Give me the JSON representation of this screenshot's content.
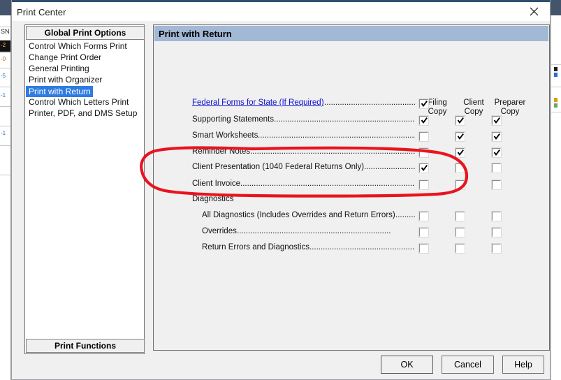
{
  "window": {
    "title": "Print Center",
    "close_icon": "close-icon"
  },
  "sidebar": {
    "header": "Global Print Options",
    "footer_button": "Print Functions",
    "items": [
      {
        "label": "Control Which Forms Print",
        "selected": false
      },
      {
        "label": "Change Print Order",
        "selected": false
      },
      {
        "label": "General Printing",
        "selected": false
      },
      {
        "label": "Print with Organizer",
        "selected": false
      },
      {
        "label": "Print with Return",
        "selected": true
      },
      {
        "label": "Control Which Letters Print",
        "selected": false
      },
      {
        "label": "Printer, PDF, and DMS Setup",
        "selected": false
      }
    ],
    "selected_index": 4
  },
  "main": {
    "header": "Print with Return",
    "columns": [
      {
        "line1": "Filing",
        "line2": "Copy"
      },
      {
        "line1": "Client",
        "line2": "Copy"
      },
      {
        "line1": "Preparer",
        "line2": "Copy"
      }
    ],
    "rows": [
      {
        "label": "Federal Forms for State (If Required)",
        "type": "link",
        "indent": false,
        "dots": "..........................................",
        "checks": [
          true,
          null,
          null
        ]
      },
      {
        "label": "Supporting Statements",
        "type": "text",
        "indent": false,
        "dots": "..................................................................",
        "checks": [
          true,
          true,
          true
        ]
      },
      {
        "label": "Smart Worksheets",
        "type": "text",
        "indent": false,
        "dots": "........................................................................",
        "checks": [
          false,
          true,
          true
        ]
      },
      {
        "label": "Reminder Notes",
        "type": "text",
        "indent": false,
        "dots": "............................................................................",
        "checks": [
          false,
          true,
          true
        ]
      },
      {
        "label": "Client Presentation (1040 Federal Returns Only)",
        "type": "text",
        "indent": false,
        "dots": "..................................",
        "checks": [
          true,
          false,
          false
        ]
      },
      {
        "label": "Client Invoice",
        "type": "text",
        "indent": false,
        "dots": "...............................................................................",
        "checks": [
          false,
          false,
          false
        ]
      },
      {
        "label": "Diagnostics",
        "type": "group",
        "indent": false,
        "dots": "",
        "checks": [
          null,
          null,
          null
        ]
      },
      {
        "label": "All Diagnostics (Includes Overrides and Return Errors)",
        "type": "text",
        "indent": true,
        "dots": "......................",
        "checks": [
          false,
          false,
          false
        ]
      },
      {
        "label": "Overrides",
        "type": "text",
        "indent": true,
        "dots": ".....................................................................",
        "checks": [
          false,
          false,
          false
        ]
      },
      {
        "label": "Return Errors and Diagnostics",
        "type": "text",
        "indent": true,
        "dots": "...........................................................",
        "checks": [
          false,
          false,
          false
        ]
      }
    ]
  },
  "footer": {
    "ok": "OK",
    "cancel": "Cancel",
    "help": "Help"
  },
  "annotation": {
    "color": "#e8141e",
    "shape": "hand-drawn-ellipse",
    "encircles": [
      "Client Presentation (1040 Federal Returns Only)",
      "Client Invoice"
    ]
  },
  "background_app": {
    "visible_sliver_text": "SN"
  },
  "colors": {
    "dialog_bg": "#f0f0f0",
    "panel_header": "#a2b8d4",
    "selection": "#2f7ce0",
    "link": "#1010cf",
    "titlebar_accent": "#2f4f6f"
  }
}
